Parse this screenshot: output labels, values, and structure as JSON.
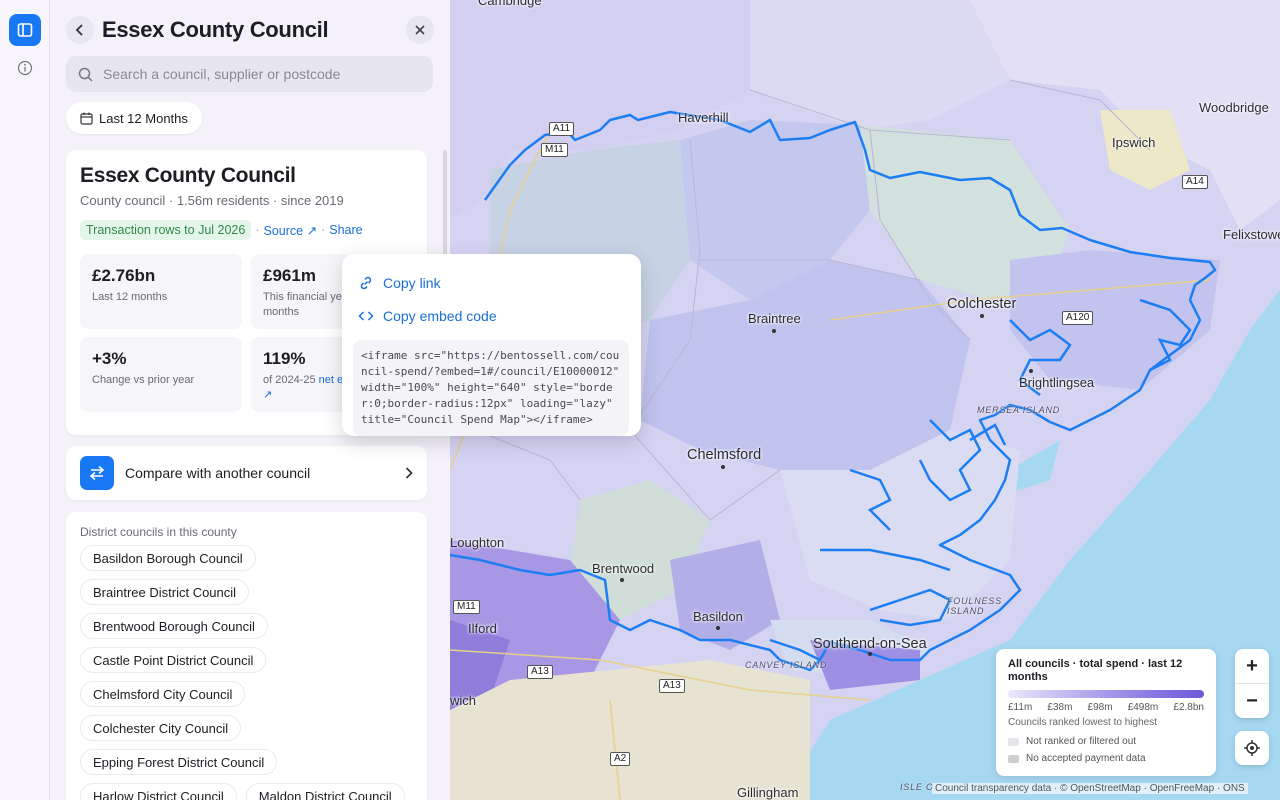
{
  "panel": {
    "title": "Essex County Council",
    "search_placeholder": "Search a council, supplier or postcode",
    "date_range": "Last 12 Months"
  },
  "summary": {
    "name": "Essex County Council",
    "meta": "County council · 1.56m residents · since 2019",
    "rows_tag": "Transaction rows to Jul 2026",
    "source_link": "Source ↗",
    "share_link": "Share",
    "stats": [
      {
        "value": "£2.76bn",
        "label": "Last 12 months"
      },
      {
        "value": "£961m",
        "label": "This financial year · 4 months"
      },
      {
        "value": "+3%",
        "label": "Change vs prior year"
      },
      {
        "value": "119%",
        "label_prefix": "of 2024-25 ",
        "label_link": "net expenditure ↗"
      }
    ]
  },
  "compare": {
    "label": "Compare with another council"
  },
  "districts": {
    "heading": "District councils in this county",
    "items": [
      "Basildon Borough Council",
      "Braintree District Council",
      "Brentwood Borough Council",
      "Castle Point District Council",
      "Chelmsford City Council",
      "Colchester City Council",
      "Epping Forest District Council",
      "Harlow District Council",
      "Maldon District Council"
    ]
  },
  "share_menu": {
    "copy_link": "Copy link",
    "copy_embed": "Copy embed code",
    "embed_code": "<iframe src=\"https://bentossell.com/council-spend/?embed=1#/council/E10000012\" width=\"100%\" height=\"640\" style=\"border:0;border-radius:12px\" loading=\"lazy\" title=\"Council Spend Map\"></iframe>"
  },
  "map": {
    "places": {
      "haverhill": "Haverhill",
      "woodbridge": "Woodbridge",
      "ipswich": "Ipswich",
      "felixstowe": "Felixstowe",
      "colchester": "Colchester",
      "braintree": "Braintree",
      "brightlingsea": "Brightlingsea",
      "chelmsford": "Chelmsford",
      "loughton": "Loughton",
      "brentwood": "Brentwood",
      "basildon": "Basildon",
      "ilford": "Ilford",
      "southend": "Southend-on-Sea",
      "gillingham": "Gillingham",
      "wich": "wich",
      "cambridge": "Cambridge"
    },
    "islands": {
      "mersea": "MERSEA ISLAND",
      "foulness": "FOULNESS ISLAND",
      "canvey": "CANVEY ISLAND",
      "sheppey": "ISLE O"
    },
    "roads": {
      "a11": "A11",
      "m11": "M11",
      "a14": "A14",
      "a120": "A120",
      "m11b": "M11",
      "a13": "A13",
      "a13b": "A13",
      "a2": "A2"
    },
    "attribution": "Council transparency data · © OpenStreetMap · OpenFreeMap · ONS"
  },
  "legend": {
    "title": "All councils · total spend · last 12 months",
    "ticks": [
      "£11m",
      "£38m",
      "£98m",
      "£498m",
      "£2.8bn"
    ],
    "note": "Councils ranked lowest to highest",
    "not_ranked": "Not ranked or filtered out",
    "no_data": "No accepted payment data",
    "colors": {
      "low": "#ebe8fa",
      "high": "#6f58d9",
      "not_ranked": "#e6e5ea",
      "no_data": "#cfcfcc"
    }
  },
  "zoom": {
    "in": "+",
    "out": "−"
  }
}
